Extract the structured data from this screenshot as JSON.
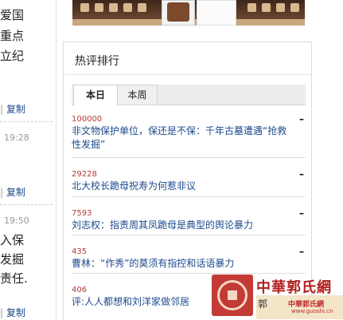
{
  "left": {
    "lines": [
      "爱国",
      "重点",
      "立纪",
      "入保",
      "发掘",
      "责任."
    ],
    "share_label": "复制",
    "times": [
      "19:28",
      "19:50"
    ]
  },
  "panel": {
    "title": "热评排行",
    "tabs": [
      {
        "label": "本日",
        "active": true
      },
      {
        "label": "本周",
        "active": false
      }
    ],
    "items": [
      {
        "count": "100000",
        "title_line1": "非文物保护单位，保还是不保：千年古墓遭遇“抢救",
        "title_line2": "性发掘”"
      },
      {
        "count": "29228",
        "title_line1": "北大校长跪母祝寿为何惹非议",
        "title_line2": ""
      },
      {
        "count": "7593",
        "title_line1": "刘志权：指责周其凤跪母是典型的舆论暴力",
        "title_line2": ""
      },
      {
        "count": "435",
        "title_line1": "曹林：“作秀”的莫须有指控和话语暴力",
        "title_line2": ""
      },
      {
        "count": "406",
        "title_line1": "评:人人都想和刘洋家做邻居",
        "title_line2": ""
      }
    ],
    "dash_symbol": "–"
  },
  "watermark": {
    "name": "中華郭氏網",
    "sub1": "郭",
    "sub2": "中華郭氏網",
    "sub3": "www.guoshi.cn"
  },
  "colors": {
    "link": "#1d4a8c",
    "count": "#b23a3a",
    "seal": "#c23b35"
  }
}
